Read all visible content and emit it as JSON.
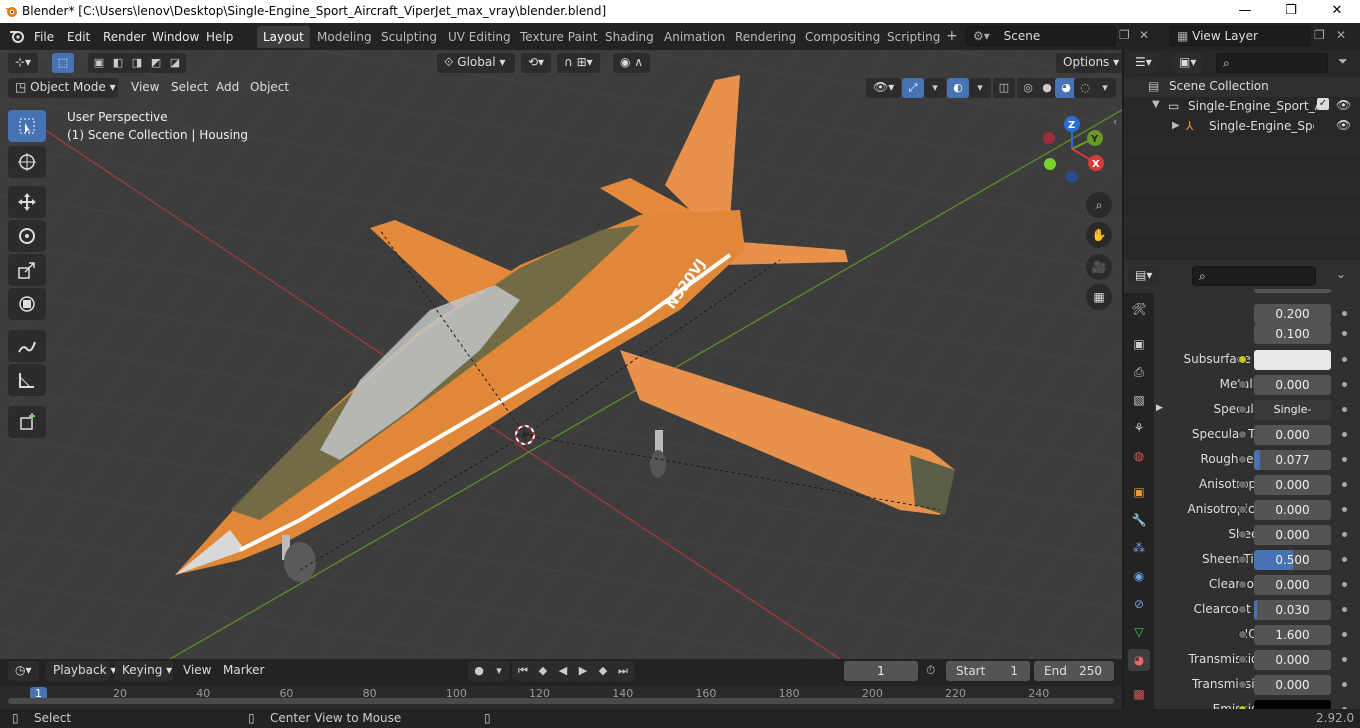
{
  "window": {
    "title": "Blender* [C:\\Users\\lenov\\Desktop\\Single-Engine_Sport_Aircraft_ViperJet_max_vray\\blender.blend]",
    "minimize": "—",
    "maximize": "❐",
    "close": "✕"
  },
  "menus": [
    "File",
    "Edit",
    "Render",
    "Window",
    "Help"
  ],
  "workspaces": [
    "Layout",
    "Modeling",
    "Sculpting",
    "UV Editing",
    "Texture Paint",
    "Shading",
    "Animation",
    "Rendering",
    "Compositing",
    "Scripting"
  ],
  "active_workspace": "Layout",
  "scene": {
    "name": "Scene"
  },
  "view_layer": {
    "name": "View Layer"
  },
  "viewport": {
    "transform_orientation": "Global",
    "options_label": "Options",
    "mode": "Object Mode",
    "menu": [
      "View",
      "Select",
      "Add",
      "Object"
    ],
    "overlay_line1": "User Perspective",
    "overlay_line2": "(1) Scene Collection | Housing",
    "gizmo": {
      "x": "X",
      "y": "Y",
      "z": "Z"
    },
    "aircraft_marking": "N520VJ"
  },
  "outliner": {
    "items": [
      "Scene Collection",
      "Single-Engine_Sport_Airc",
      "Single-Engine_Sport_"
    ]
  },
  "properties": {
    "top_values": [
      "0.200",
      "0.100"
    ],
    "rows": [
      {
        "label": "Subsurface ...",
        "value": "",
        "type": "color",
        "color": "#e8e8e8",
        "dot": "yellow"
      },
      {
        "label": "Metallic",
        "value": "0.000",
        "type": "num",
        "fill": 0
      },
      {
        "label": "Specular",
        "value": "Single-Engine...",
        "type": "link",
        "expand": "▶"
      },
      {
        "label": "Specular Tin",
        "value": "0.000",
        "type": "num",
        "fill": 0
      },
      {
        "label": "Roughness",
        "value": "0.077",
        "type": "num",
        "fill": 0.077
      },
      {
        "label": "Anisotropic",
        "value": "0.000",
        "type": "num",
        "fill": 0
      },
      {
        "label": "Anisotropic...",
        "value": "0.000",
        "type": "num",
        "fill": 0
      },
      {
        "label": "Sheen",
        "value": "0.000",
        "type": "num",
        "fill": 0
      },
      {
        "label": "Sheen Tint",
        "value": "0.500",
        "type": "num",
        "fill": 0.5
      },
      {
        "label": "Clearcoat",
        "value": "0.000",
        "type": "num",
        "fill": 0
      },
      {
        "label": "Clearcoat ...",
        "value": "0.030",
        "type": "num",
        "fill": 0.03
      },
      {
        "label": "IOR",
        "value": "1.600",
        "type": "num",
        "fill": 0
      },
      {
        "label": "Transmission",
        "value": "0.000",
        "type": "num",
        "fill": 0
      },
      {
        "label": "Transmissi...",
        "value": "0.000",
        "type": "num",
        "fill": 0
      },
      {
        "label": "Emission",
        "value": "",
        "type": "color",
        "color": "#000000",
        "dot": "yellow"
      }
    ]
  },
  "timeline": {
    "menus": [
      "Playback",
      "Keying",
      "View",
      "Marker"
    ],
    "current_frame": "1",
    "start_label": "Start",
    "start": "1",
    "end_label": "End",
    "end": "250",
    "ruler": [
      "1",
      "20",
      "40",
      "60",
      "80",
      "100",
      "120",
      "140",
      "160",
      "180",
      "200",
      "220",
      "240"
    ]
  },
  "statusbar": {
    "left": "Select",
    "middle": "Center View to Mouse",
    "version": "2.92.0"
  }
}
